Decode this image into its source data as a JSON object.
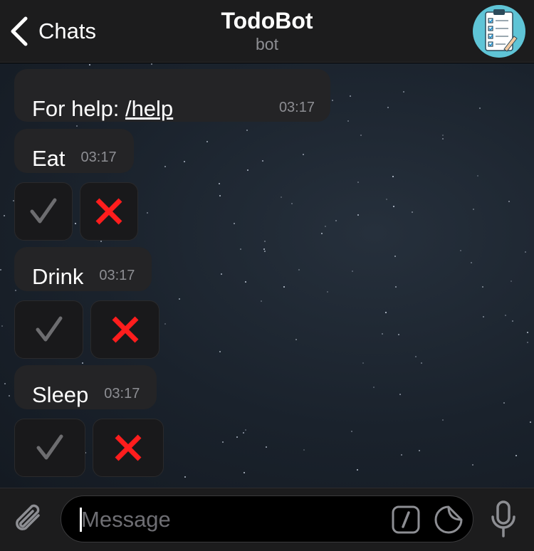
{
  "header": {
    "back_label": "Chats",
    "title": "TodoBot",
    "subtitle": "bot"
  },
  "messages": [
    {
      "prefix": "For help: ",
      "link": "/help",
      "time": "03:17"
    },
    {
      "text": "Eat",
      "time": "03:17"
    },
    {
      "text": "Drink",
      "time": "03:17"
    },
    {
      "text": "Sleep",
      "time": "03:17"
    }
  ],
  "keyboard": {
    "done_icon": "checkmark-icon",
    "delete_icon": "cross-mark-icon",
    "done_color": "#6d6d70",
    "delete_color": "#ff1d1d"
  },
  "composer": {
    "placeholder": "Message"
  },
  "colors": {
    "header_bg": "#1c1c1d",
    "bubble_bg": "#242426",
    "accent_avatar": "#5fc4d6"
  }
}
